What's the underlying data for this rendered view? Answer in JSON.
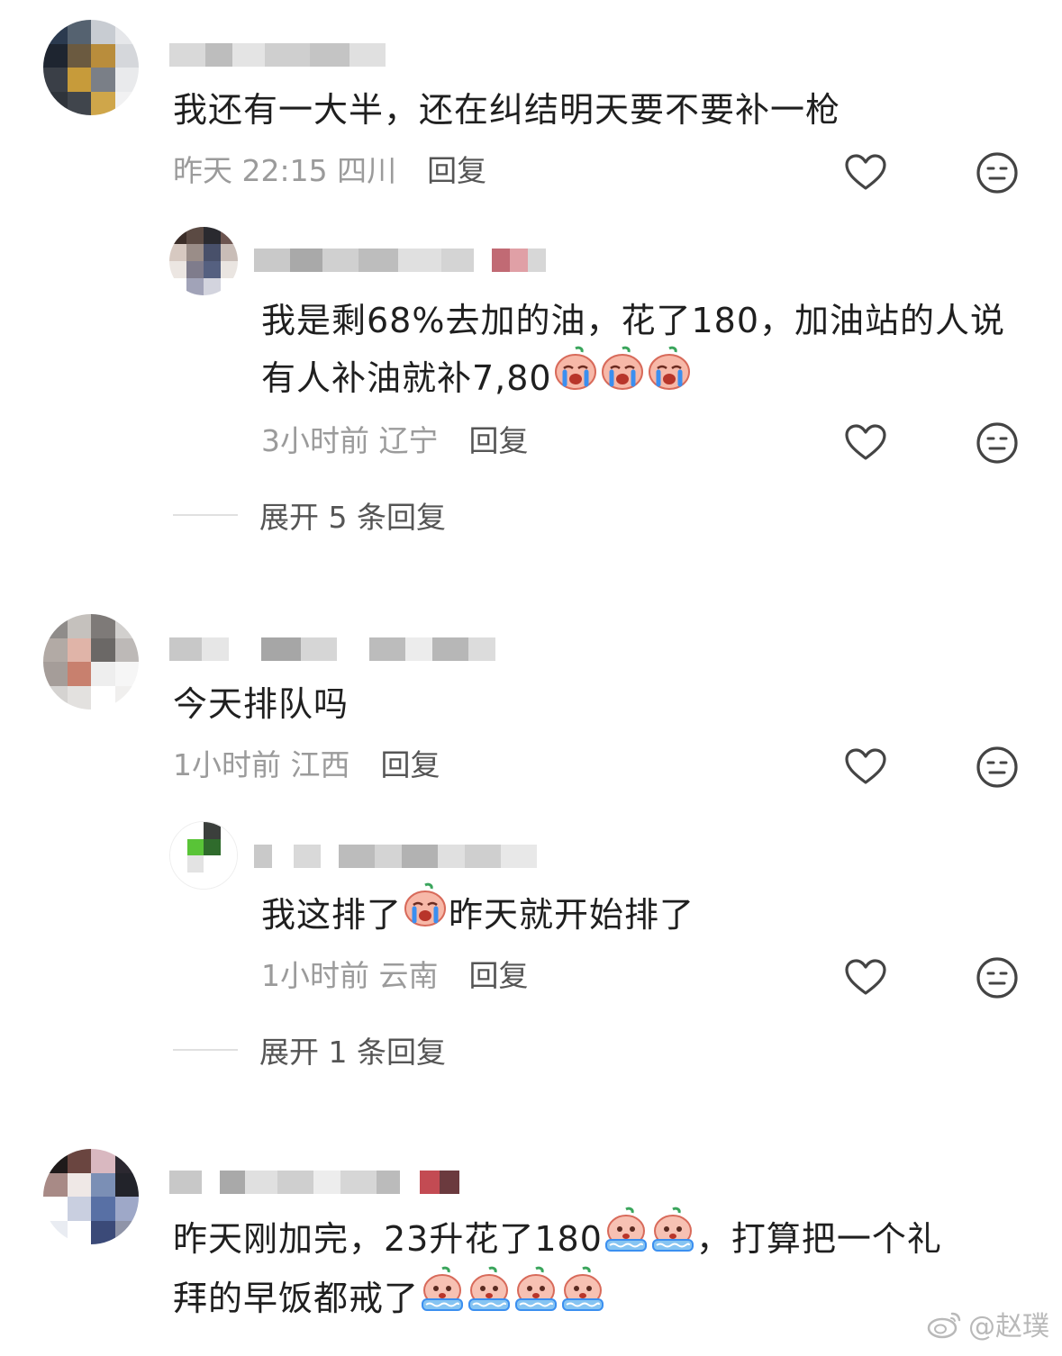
{
  "comments": [
    {
      "text": "我还有一大半，还在纠结明天要不要补一枪",
      "meta": "昨天 22:15 四川",
      "reply_label": "回复",
      "replies": [
        {
          "text": "我是剩68%去加的油，花了180，加油站的人说有人补油就补7,80",
          "meta": "3小时前 辽宁",
          "reply_label": "回复"
        }
      ],
      "expand_label": "展开 5 条回复"
    },
    {
      "text": "今天排队吗",
      "meta": "1小时前 江西",
      "reply_label": "回复",
      "replies": [
        {
          "text_before": "我这排了",
          "text_after": "昨天就开始排了",
          "meta": "1小时前 云南",
          "reply_label": "回复"
        }
      ],
      "expand_label": "展开 1 条回复"
    },
    {
      "text": "昨天刚加完，23升花了180",
      "text_mid": "，打算把一个礼",
      "text_line2": "拜的早饭都戒了",
      "meta": ""
    }
  ],
  "icons": {
    "like": "heart-outline-icon",
    "dislike": "neutral-face-icon",
    "emoji_cry": "crying-peach-emoji",
    "emoji_sob": "sobbing-peach-emoji"
  },
  "watermark": "@赵璞",
  "colors": {
    "meta": "#9b9b9b",
    "reply": "#555555",
    "text": "#1f1f1f"
  }
}
